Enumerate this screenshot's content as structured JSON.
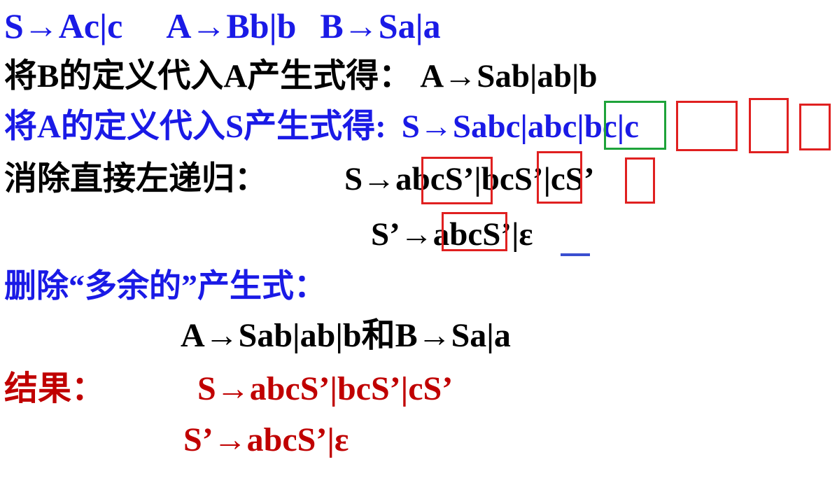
{
  "slide": {
    "grammar": {
      "rule_s": "S→Ac|c",
      "rule_a": "A→Bb|b",
      "rule_b": "B→Sa|a"
    },
    "step1": {
      "label": "将B的定义代入A产生式得：",
      "result": "A→Sab|ab|b"
    },
    "step2": {
      "label": "将A的定义代入S产生式得:",
      "result": "S→Sabc|abc|bc|c"
    },
    "step3": {
      "label": "消除直接左递归：",
      "result_s": "S→abcS’|bcS’|cS’",
      "result_s_prime": "S’→abcS’|ε"
    },
    "step4": {
      "label": "删除“多余的”产生式：",
      "result": "A→Sab|ab|b和B→Sa|a"
    },
    "conclusion": {
      "label": "结果：",
      "result_s": "S→abcS’|bcS’|cS’",
      "result_s_prime": "S’→abcS’|ε"
    }
  },
  "colors": {
    "blue_text": "#1a1ae6",
    "black_text": "#000000",
    "red_text": "#c00000",
    "highlight_box_red": "#e02020",
    "highlight_box_green": "#1ea33a",
    "underline_blue": "#3a4fd0"
  }
}
